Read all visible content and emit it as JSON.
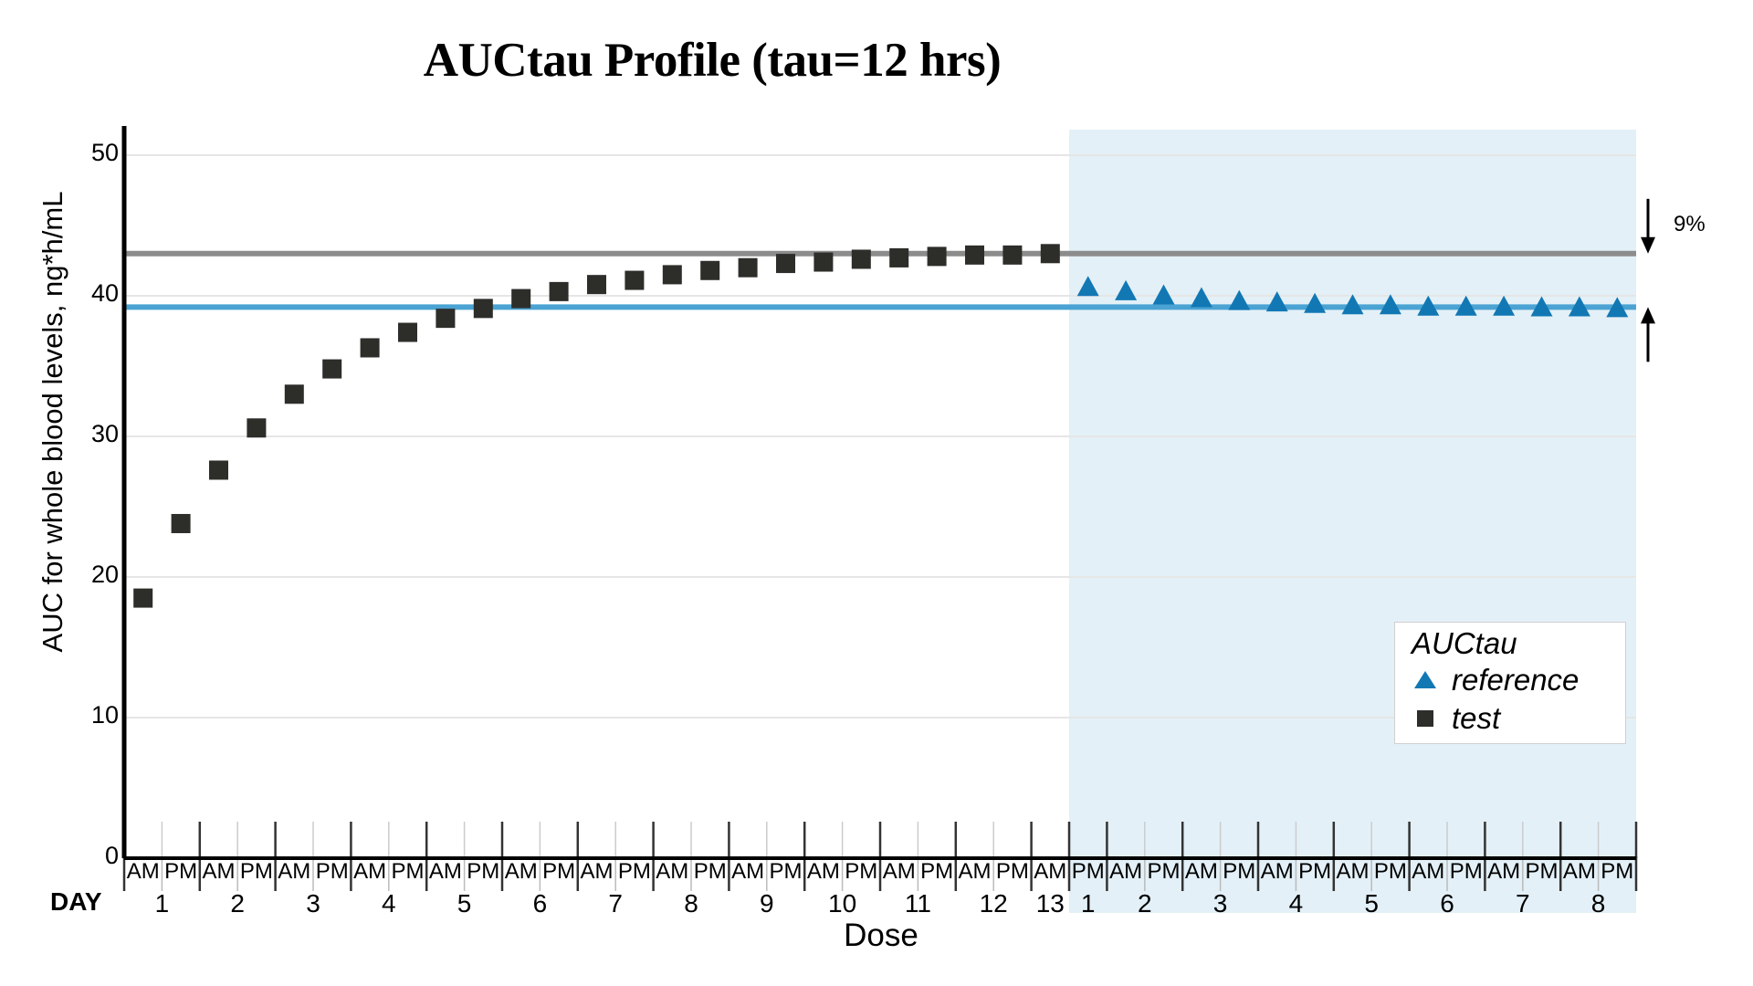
{
  "title": "AUCtau Profile (tau=12 hrs)",
  "axes": {
    "ylabel": "AUC for whole blood levels, ng*h/mL",
    "xlabel": "Dose",
    "day_word": "DAY",
    "yticks": [
      "0",
      "10",
      "20",
      "30",
      "40",
      "50"
    ]
  },
  "legend": {
    "title": "AUCtau",
    "items": [
      {
        "label": "reference",
        "marker": "triangle",
        "color": "#1278b4"
      },
      {
        "label": "test",
        "marker": "square",
        "color": "#2d2d2a"
      }
    ]
  },
  "annotation": {
    "percent": "9%",
    "arrow_top_value": 43.0,
    "arrow_bottom_value": 39.2
  },
  "colors": {
    "test_marker": "#2d2d2a",
    "reference_marker": "#1278b4",
    "test_line": "#8c8c8c",
    "reference_line": "#4ba3d3",
    "shaded_region": "#e3f0f7",
    "gridline": "#e6e6e6",
    "axis": "#000000"
  },
  "chart_data": {
    "type": "scatter",
    "title": "AUCtau Profile (tau=12 hrs)",
    "xlabel": "Dose",
    "ylabel": "AUC for whole blood levels, ng*h/mL",
    "ylim": [
      0,
      50
    ],
    "ytick_values": [
      0,
      10,
      20,
      30,
      40,
      50
    ],
    "grid": "horizontal",
    "legend_position": "inside-bottom-right",
    "x_categories": [
      {
        "dose": "AM",
        "day": "1",
        "phase": "test"
      },
      {
        "dose": "PM",
        "day": "1",
        "phase": "test"
      },
      {
        "dose": "AM",
        "day": "2",
        "phase": "test"
      },
      {
        "dose": "PM",
        "day": "2",
        "phase": "test"
      },
      {
        "dose": "AM",
        "day": "3",
        "phase": "test"
      },
      {
        "dose": "PM",
        "day": "3",
        "phase": "test"
      },
      {
        "dose": "AM",
        "day": "4",
        "phase": "test"
      },
      {
        "dose": "PM",
        "day": "4",
        "phase": "test"
      },
      {
        "dose": "AM",
        "day": "5",
        "phase": "test"
      },
      {
        "dose": "PM",
        "day": "5",
        "phase": "test"
      },
      {
        "dose": "AM",
        "day": "6",
        "phase": "test"
      },
      {
        "dose": "PM",
        "day": "6",
        "phase": "test"
      },
      {
        "dose": "AM",
        "day": "7",
        "phase": "test"
      },
      {
        "dose": "PM",
        "day": "7",
        "phase": "test"
      },
      {
        "dose": "AM",
        "day": "8",
        "phase": "test"
      },
      {
        "dose": "PM",
        "day": "8",
        "phase": "test"
      },
      {
        "dose": "AM",
        "day": "9",
        "phase": "test"
      },
      {
        "dose": "PM",
        "day": "9",
        "phase": "test"
      },
      {
        "dose": "AM",
        "day": "10",
        "phase": "test"
      },
      {
        "dose": "PM",
        "day": "10",
        "phase": "test"
      },
      {
        "dose": "AM",
        "day": "11",
        "phase": "test"
      },
      {
        "dose": "PM",
        "day": "11",
        "phase": "test"
      },
      {
        "dose": "AM",
        "day": "12",
        "phase": "test"
      },
      {
        "dose": "PM",
        "day": "12",
        "phase": "test"
      },
      {
        "dose": "AM",
        "day": "13",
        "phase": "test"
      },
      {
        "dose": "PM",
        "day": "1",
        "phase": "reference"
      },
      {
        "dose": "AM",
        "day": "2",
        "phase": "reference"
      },
      {
        "dose": "PM",
        "day": "2",
        "phase": "reference"
      },
      {
        "dose": "AM",
        "day": "3",
        "phase": "reference"
      },
      {
        "dose": "PM",
        "day": "3",
        "phase": "reference"
      },
      {
        "dose": "AM",
        "day": "4",
        "phase": "reference"
      },
      {
        "dose": "PM",
        "day": "4",
        "phase": "reference"
      },
      {
        "dose": "AM",
        "day": "5",
        "phase": "reference"
      },
      {
        "dose": "PM",
        "day": "5",
        "phase": "reference"
      },
      {
        "dose": "AM",
        "day": "6",
        "phase": "reference"
      },
      {
        "dose": "PM",
        "day": "6",
        "phase": "reference"
      },
      {
        "dose": "AM",
        "day": "7",
        "phase": "reference"
      },
      {
        "dose": "PM",
        "day": "7",
        "phase": "reference"
      },
      {
        "dose": "AM",
        "day": "8",
        "phase": "reference"
      },
      {
        "dose": "PM",
        "day": "8",
        "phase": "reference"
      }
    ],
    "series": [
      {
        "name": "test",
        "marker": "square",
        "color": "#2d2d2a",
        "x_index": [
          0,
          1,
          2,
          3,
          4,
          5,
          6,
          7,
          8,
          9,
          10,
          11,
          12,
          13,
          14,
          15,
          16,
          17,
          18,
          19,
          20,
          21,
          22,
          23,
          24
        ],
        "values": [
          18.5,
          23.8,
          27.6,
          30.6,
          33.0,
          34.8,
          36.3,
          37.4,
          38.4,
          39.1,
          39.8,
          40.3,
          40.8,
          41.1,
          41.5,
          41.8,
          42.0,
          42.3,
          42.4,
          42.6,
          42.7,
          42.8,
          42.9,
          42.9,
          43.0
        ]
      },
      {
        "name": "reference",
        "marker": "triangle",
        "color": "#1278b4",
        "x_index": [
          25,
          26,
          27,
          28,
          29,
          30,
          31,
          32,
          33,
          34,
          35,
          36,
          37,
          38,
          39
        ],
        "values": [
          40.7,
          40.4,
          40.1,
          39.9,
          39.7,
          39.6,
          39.5,
          39.4,
          39.4,
          39.3,
          39.3,
          39.3,
          39.25,
          39.25,
          39.2
        ]
      }
    ],
    "reference_lines": [
      {
        "name": "test steady state",
        "value": 43.0,
        "color": "#8c8c8c"
      },
      {
        "name": "reference steady state",
        "value": 39.2,
        "color": "#4ba3d3"
      }
    ],
    "shaded_regions": [
      {
        "name": "reference period",
        "from_index": 25,
        "to_index": 40,
        "color": "#e3f0f7"
      }
    ],
    "annotations": [
      {
        "text": "9%",
        "from_value": 43.0,
        "to_value": 39.2
      }
    ]
  }
}
